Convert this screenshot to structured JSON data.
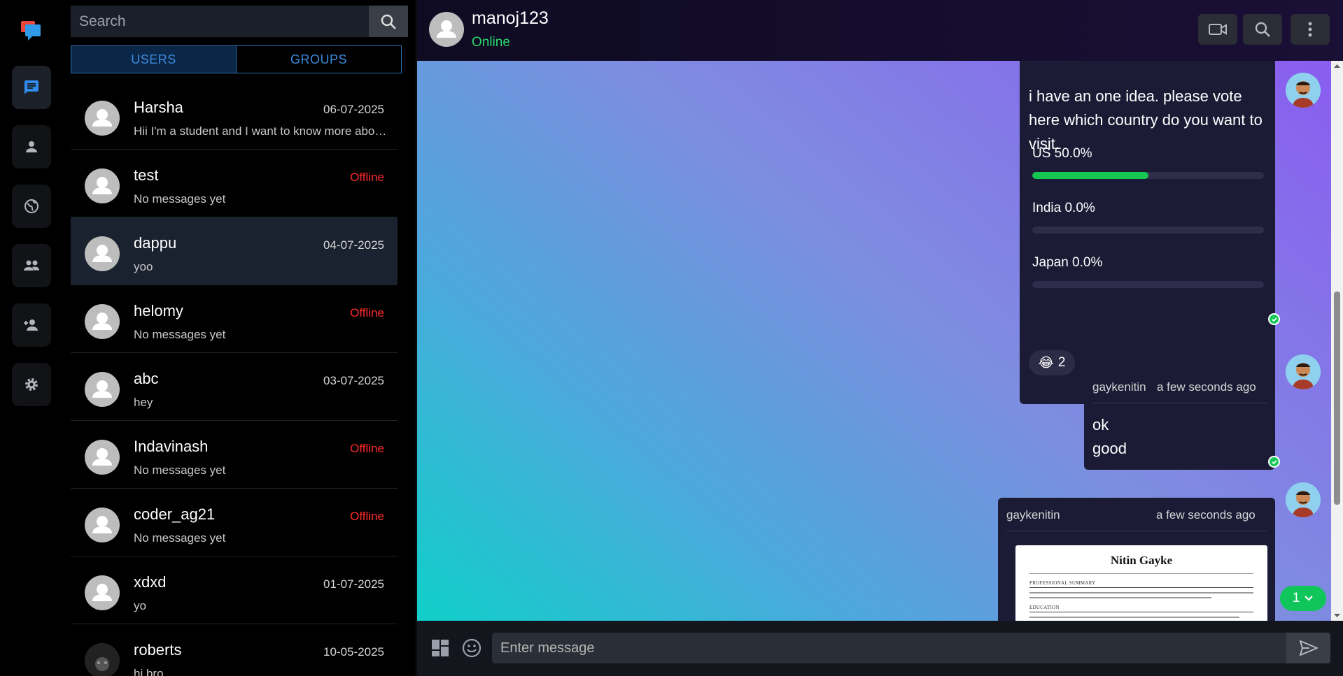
{
  "search": {
    "placeholder": "Search"
  },
  "tabs": {
    "users": "USERS",
    "groups": "GROUPS"
  },
  "contacts": [
    {
      "name": "Harsha",
      "date": "06-07-2025",
      "message": "Hii I'm a student and I want to know more about this"
    },
    {
      "name": "test",
      "date": "Offline",
      "message": "No messages yet"
    },
    {
      "name": "dappu",
      "date": "04-07-2025",
      "message": "yoo"
    },
    {
      "name": "helomy",
      "date": "Offline",
      "message": "No messages yet"
    },
    {
      "name": "abc",
      "date": "03-07-2025",
      "message": "hey"
    },
    {
      "name": "Indavinash",
      "date": "Offline",
      "message": "No messages yet"
    },
    {
      "name": "coder_ag21",
      "date": "Offline",
      "message": "No messages yet"
    },
    {
      "name": "xdxd",
      "date": "01-07-2025",
      "message": "yo"
    },
    {
      "name": "roberts",
      "date": "10-05-2025",
      "message": "hi bro"
    }
  ],
  "chat": {
    "name": "manoj123",
    "status": "Online"
  },
  "poll": {
    "question": "i have an one idea. please vote here which country do you want to visit.",
    "options": [
      {
        "label": "US  50.0%",
        "percent": 50
      },
      {
        "label": "India  0.0%",
        "percent": 0
      },
      {
        "label": "Japan  0.0%",
        "percent": 0
      }
    ],
    "reaction_emoji": "😂",
    "reaction_count": "2"
  },
  "text_message": {
    "sender": "gaykenitin",
    "time": "a few seconds ago",
    "line1": "ok",
    "line2": "good"
  },
  "file_message": {
    "sender": "gaykenitin",
    "time": "a few seconds ago",
    "doc_title": "Nitin Gayke",
    "doc_section1": "PROFESSIONAL SUMMARY",
    "doc_section2": "EDUCATION"
  },
  "new_messages_badge": "1",
  "composer": {
    "placeholder": "Enter message"
  },
  "colors": {
    "accent": "#3d8be0",
    "online": "#2bd86a",
    "offline": "#ff2b2b",
    "poll_fill": "#16c653"
  }
}
